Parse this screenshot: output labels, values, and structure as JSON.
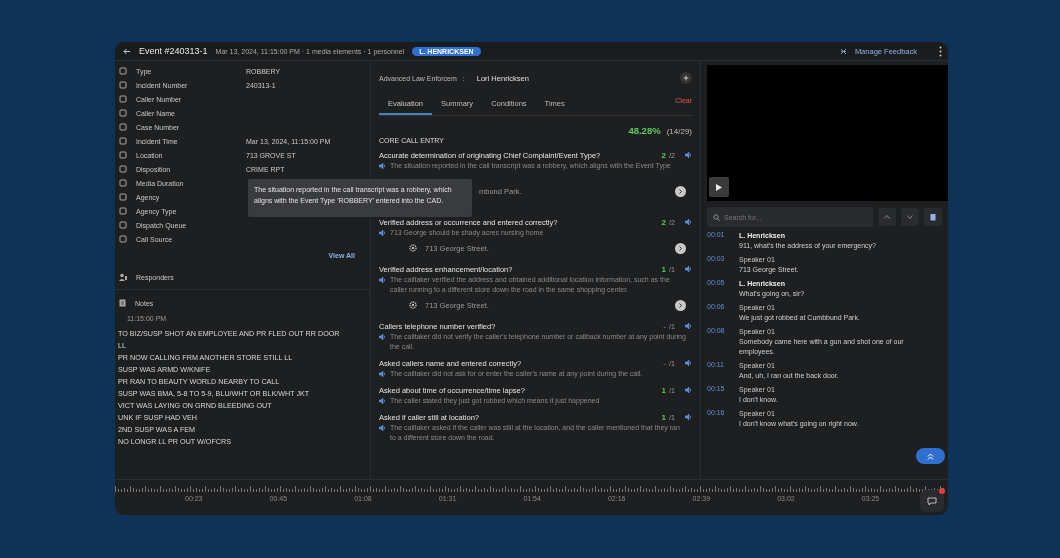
{
  "header": {
    "title": "Event #240313-1",
    "meta": "Mar 13, 2024, 11:15:00 PM · 1 media elements · 1 personnel",
    "badge": "L. HENRICKSEN",
    "feedback": "Manage Feedback"
  },
  "details": {
    "fields": [
      {
        "label": "Type",
        "value": "ROBBERY"
      },
      {
        "label": "Incident Number",
        "value": "240313-1"
      },
      {
        "label": "Caller Number"
      },
      {
        "label": "Caller Name"
      },
      {
        "label": "Case Number"
      },
      {
        "label": "Incident Time",
        "value": "Mar 13, 2024, 11:15:00 PM"
      },
      {
        "label": "Location",
        "value": "713 GROVE ST"
      },
      {
        "label": "Disposition",
        "value": "CRIME RPT"
      },
      {
        "label": "Media Duration"
      },
      {
        "label": "Agency"
      },
      {
        "label": "Agency Type"
      },
      {
        "label": "Dispatch Queue"
      },
      {
        "label": "Call Source"
      }
    ],
    "view_all": "View All",
    "responders": "Responders",
    "notes": "Notes",
    "note_time": "11:15:00 PM",
    "note_lines": [
      "TO BIZ/SUSP SHOT AN EMPLOYEE AND PR FLED OUT RR DOOR",
      "LL",
      "PR NOW CALLING FRM ANOTHER STORE  STILL LL",
      "SUSP WAS ARMD W/KNIFE",
      "PR RAN TO BEAUTY WORLD NEARBY TO CALL",
      "SUSP WAS BMA, 5-8 TO 5-9, BLU/WHT OR BLK/WHT JKT",
      "VICT WAS LAYING ON GRND BLEEDING OUT",
      "UNK IF SUSP HAD VEH",
      "2ND SUSP WAS A FEM",
      "NO LONGR LL  PR OUT W/OFCRS"
    ]
  },
  "tooltip": "The situation reported in the call transcript was a robbery, which aligns with the Event Type 'ROBBERY' entered into the CAD.",
  "evaluation": {
    "form": "Advanced Law Enforcem",
    "separator": ":",
    "evaluator": "Lori Henricksen",
    "tabs": [
      {
        "label": "Evaluation",
        "selected": true
      },
      {
        "label": "Summary",
        "selected": false
      },
      {
        "label": "Conditions",
        "selected": false
      },
      {
        "label": "Times",
        "selected": false
      }
    ],
    "clear": "Clear",
    "percent": "48.28%",
    "ratio": "(14/29)",
    "section": "CORE CALL ENTRY",
    "questions": [
      {
        "text": "Accurate determination of originating Chief Complaint/Event Type?",
        "earned": "2",
        "max": "/2",
        "scored": true,
        "explanation": "The situation reported in the call transcript was a robbery, which aligns with the Event Type",
        "location": {
          "text": "mbund Park.",
          "icon": false
        }
      },
      {
        "text": "Verified address or occurrence and entered correctly?",
        "earned": "2",
        "max": "/2",
        "scored": true,
        "explanation": "713 George should be shady acres nursing home",
        "location": {
          "text": "713 George Street.",
          "icon": true
        }
      },
      {
        "text": "Verified address enhancement/location?",
        "earned": "1",
        "max": "/1",
        "scored": true,
        "explanation": "The calltaker verified the address and obtained additional location information, such as the caller running to a different store down the road in the same shopping center.",
        "location": {
          "text": "713 George Street.",
          "icon": true
        }
      },
      {
        "text": "Callers telephone number verified?",
        "earned": "-",
        "max": "/1",
        "scored": false,
        "explanation": "The calltaker did not verify the caller's telephone number or callback number at any point during the call."
      },
      {
        "text": "Asked callers name and entered correctly?",
        "earned": "-",
        "max": "/1",
        "scored": false,
        "explanation": "The calltaker did not ask for or enter the caller's name at any point during the call."
      },
      {
        "text": "Asked about time of occurrence/time lapse?",
        "earned": "1",
        "max": "/1",
        "scored": true,
        "explanation": "The caller stated they just got robbed which means it just happened"
      },
      {
        "text": "Asked if caller still at location?",
        "earned": "1",
        "max": "/1",
        "scored": true,
        "explanation": "The calltaker asked if the caller was still at the location, and the caller mentioned that they ran to a different store down the road."
      }
    ]
  },
  "transcript": {
    "search_placeholder": "Search for...",
    "entries": [
      {
        "time": "00:01",
        "speaker": "L. Henricksen",
        "agent": true,
        "text": "911, what's the address of your emergency?"
      },
      {
        "time": "00:03",
        "speaker": "Speaker 01",
        "agent": false,
        "text": "713 George Street."
      },
      {
        "time": "00:05",
        "speaker": "L. Henricksen",
        "agent": true,
        "text": "What's going on, sir?"
      },
      {
        "time": "00:06",
        "speaker": "Speaker 01",
        "agent": false,
        "text": "We just got robbed at Cumbbund Park."
      },
      {
        "time": "00:08",
        "speaker": "Speaker 01",
        "agent": false,
        "text": "Somebody came here with a gun and shot one of our employees."
      },
      {
        "time": "00:11",
        "speaker": "Speaker 01",
        "agent": false,
        "text": "And, uh, I ran out the back door."
      },
      {
        "time": "00:15",
        "speaker": "Speaker 01",
        "agent": false,
        "text": "I don't know."
      },
      {
        "time": "00:16",
        "speaker": "Speaker 01",
        "agent": false,
        "text": "I don't know what's going on right now."
      }
    ]
  },
  "timeline": {
    "labels": [
      "00:23",
      "00:45",
      "01:08",
      "01:31",
      "01:54",
      "02:16",
      "02:39",
      "03:02",
      "03:25"
    ]
  }
}
